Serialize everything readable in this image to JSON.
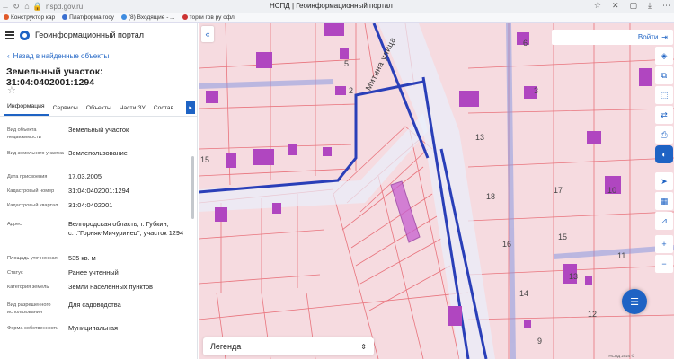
{
  "browser": {
    "address": "nspd.gov.ru",
    "tab_title": "НСПД | Геоинформационный портал",
    "bookmarks": [
      "Конструктор кар",
      "Платформа госу",
      "(8) Входящие - ...",
      "торги гов ру офл"
    ]
  },
  "colors": {
    "accent": "#1e63c4",
    "parcel_fill": "#f6dbe0",
    "parcel_line": "#e8737c",
    "building": "#b046c0",
    "road": "#2a3fb8"
  },
  "portal": {
    "name": "Геоинформационный портал"
  },
  "back_link": "Назад в найденные объекты",
  "object_title": "Земельный участок: 31:04:0402001:1294",
  "tabs": [
    "Информация",
    "Сервисы",
    "Объекты",
    "Части ЗУ",
    "Состав"
  ],
  "properties": [
    {
      "key": "Вид объекта недвижимости",
      "value": "Земельный участок"
    },
    {
      "key": "Вид земельного участка",
      "value": "Землепользование"
    },
    {
      "key": "Дата присвоения",
      "value": "17.03.2005"
    },
    {
      "key": "Кадастровый номер",
      "value": "31:04:0402001:1294"
    },
    {
      "key": "Кадастровый квартал",
      "value": "31:04:0402001"
    },
    {
      "key": "Адрес",
      "value": "Белгородская область, г. Губкин, с.т.\"Горняк-Мичуринец\", участок 1294"
    },
    {
      "key": "Площадь уточненная",
      "value": "535 кв. м"
    },
    {
      "key": "Статус",
      "value": "Ранее учтенный"
    },
    {
      "key": "Категория земель",
      "value": "Земли населенных пунктов"
    },
    {
      "key": "Вид разрешенного использования",
      "value": "Для садоводства"
    },
    {
      "key": "Форма собственности",
      "value": "Муниципальная"
    }
  ],
  "map": {
    "login": "Войти",
    "street_label": "Митина улица",
    "legend": "Легенда",
    "attribution": "НСПД 2024 ©",
    "parcel_numbers": [
      "6",
      "5",
      "3",
      "2",
      "15",
      "18",
      "17",
      "16",
      "15",
      "10",
      "11",
      "13",
      "14",
      "12",
      "13",
      "9"
    ]
  }
}
